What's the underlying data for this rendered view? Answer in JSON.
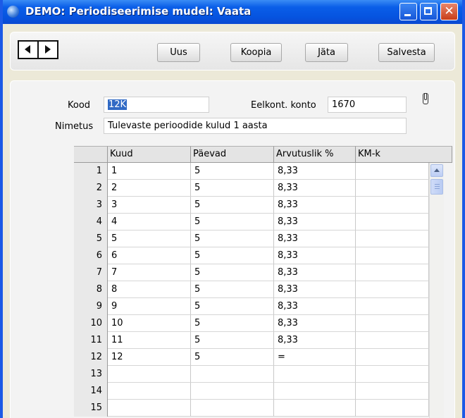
{
  "window": {
    "title": "DEMO: Periodiseerimise mudel: Vaata",
    "close_glyph": "✕"
  },
  "icons": {
    "app": "app-globe-icon",
    "prev": "triangle-left-icon",
    "next": "triangle-right-icon",
    "attachment": "paperclip-icon"
  },
  "toolbar": {
    "new_label": "Uus",
    "copy_label": "Koopia",
    "leave_label": "Jäta",
    "save_label": "Salvesta"
  },
  "form": {
    "kood_label": "Kood",
    "kood_value": "12K",
    "eelkont_label": "Eelkont. konto",
    "eelkont_value": "1670",
    "nimetus_label": "Nimetus",
    "nimetus_value": "Tulevaste perioodide kulud 1 aasta"
  },
  "table": {
    "columns": [
      "Kuud",
      "Päevad",
      "Arvutuslik %",
      "KM-k"
    ],
    "rows": [
      {
        "n": "1",
        "kuud": "1",
        "paevad": "5",
        "arvutuslik": "8,33",
        "kmk": ""
      },
      {
        "n": "2",
        "kuud": "2",
        "paevad": "5",
        "arvutuslik": "8,33",
        "kmk": ""
      },
      {
        "n": "3",
        "kuud": "3",
        "paevad": "5",
        "arvutuslik": "8,33",
        "kmk": ""
      },
      {
        "n": "4",
        "kuud": "4",
        "paevad": "5",
        "arvutuslik": "8,33",
        "kmk": ""
      },
      {
        "n": "5",
        "kuud": "5",
        "paevad": "5",
        "arvutuslik": "8,33",
        "kmk": ""
      },
      {
        "n": "6",
        "kuud": "6",
        "paevad": "5",
        "arvutuslik": "8,33",
        "kmk": ""
      },
      {
        "n": "7",
        "kuud": "7",
        "paevad": "5",
        "arvutuslik": "8,33",
        "kmk": ""
      },
      {
        "n": "8",
        "kuud": "8",
        "paevad": "5",
        "arvutuslik": "8,33",
        "kmk": ""
      },
      {
        "n": "9",
        "kuud": "9",
        "paevad": "5",
        "arvutuslik": "8,33",
        "kmk": ""
      },
      {
        "n": "10",
        "kuud": "10",
        "paevad": "5",
        "arvutuslik": "8,33",
        "kmk": ""
      },
      {
        "n": "11",
        "kuud": "11",
        "paevad": "5",
        "arvutuslik": "8,33",
        "kmk": ""
      },
      {
        "n": "12",
        "kuud": "12",
        "paevad": "5",
        "arvutuslik": "=",
        "kmk": ""
      },
      {
        "n": "13",
        "kuud": "",
        "paevad": "",
        "arvutuslik": "",
        "kmk": ""
      },
      {
        "n": "14",
        "kuud": "",
        "paevad": "",
        "arvutuslik": "",
        "kmk": ""
      },
      {
        "n": "15",
        "kuud": "",
        "paevad": "",
        "arvutuslik": "",
        "kmk": ""
      }
    ]
  }
}
